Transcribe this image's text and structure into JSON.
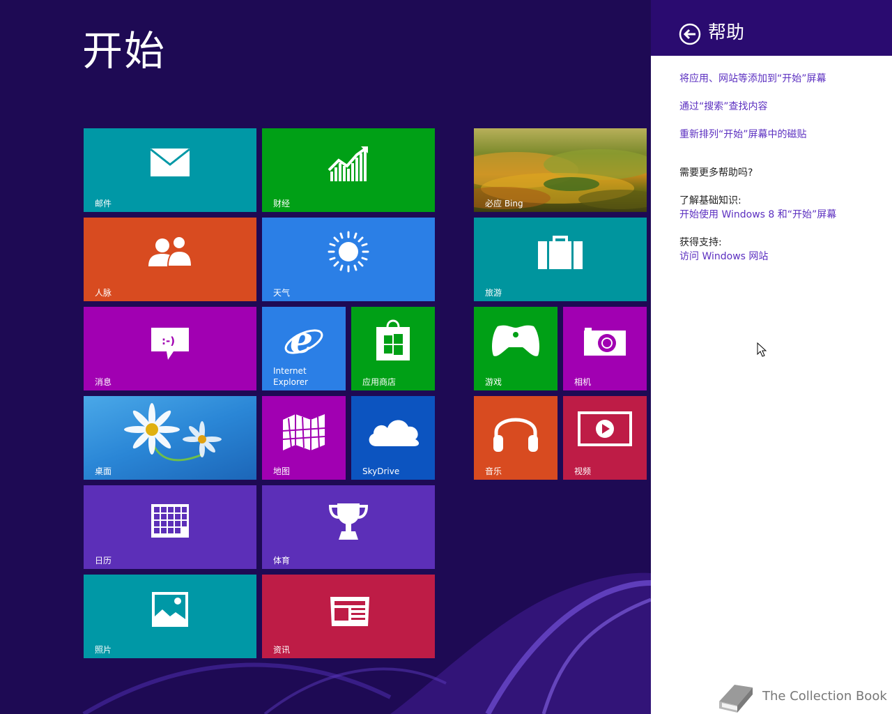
{
  "start": {
    "title": "开始",
    "tiles": {
      "mail": "邮件",
      "finance": "财经",
      "bing": "必应 Bing",
      "people": "人脉",
      "weather": "天气",
      "travel": "旅游",
      "messaging": "消息",
      "ie": "Internet\nExplorer",
      "store": "应用商店",
      "games": "游戏",
      "camera": "相机",
      "desktop": "桌面",
      "maps": "地图",
      "skydrive": "SkyDrive",
      "music": "音乐",
      "video": "视频",
      "calendar": "日历",
      "sports": "体育",
      "photos": "照片",
      "news": "资讯"
    }
  },
  "help_pane": {
    "title": "帮助",
    "links": [
      "将应用、网站等添加到“开始”屏幕",
      "通过“搜索”查找内容",
      "重新排列“开始”屏幕中的磁贴"
    ],
    "more_help": "需要更多帮助吗?",
    "basics_label": "了解基础知识:",
    "basics_link": "开始使用 Windows 8 和“开始”屏幕",
    "support_label": "获得支持:",
    "support_link": "访问 Windows 网站"
  },
  "watermark": "The Collection Book",
  "colors": {
    "background": "#1e0a54",
    "charm_header": "#2a0b70",
    "link": "#5b2fc0"
  }
}
